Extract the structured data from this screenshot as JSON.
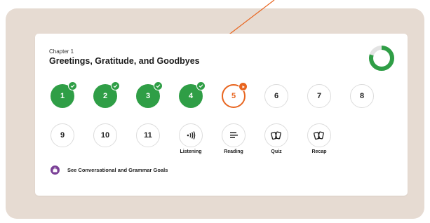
{
  "chapter": {
    "label": "Chapter 1",
    "title": "Greetings, Gratitude, and Goodbyes",
    "progress_fraction": 0.8
  },
  "lessons": [
    {
      "label": "1",
      "status": "completed"
    },
    {
      "label": "2",
      "status": "completed"
    },
    {
      "label": "3",
      "status": "completed"
    },
    {
      "label": "4",
      "status": "completed"
    },
    {
      "label": "5",
      "status": "in-progress"
    },
    {
      "label": "6",
      "status": "locked"
    },
    {
      "label": "7",
      "status": "locked"
    },
    {
      "label": "8",
      "status": "locked"
    },
    {
      "label": "9",
      "status": "locked"
    },
    {
      "label": "10",
      "status": "locked"
    },
    {
      "label": "11",
      "status": "locked"
    }
  ],
  "activities": [
    {
      "label": "Listening",
      "icon": "listening-icon"
    },
    {
      "label": "Reading",
      "icon": "reading-icon"
    },
    {
      "label": "Quiz",
      "icon": "cards-icon"
    },
    {
      "label": "Recap",
      "icon": "cards-icon"
    }
  ],
  "goals_link": {
    "label": "See Conversational and Grammar Goals",
    "icon": "goals-icon"
  },
  "colors": {
    "completed": "#2f9e46",
    "current": "#e8651f",
    "accent_purple": "#7a3f96",
    "backdrop": "#e6dbd2"
  }
}
